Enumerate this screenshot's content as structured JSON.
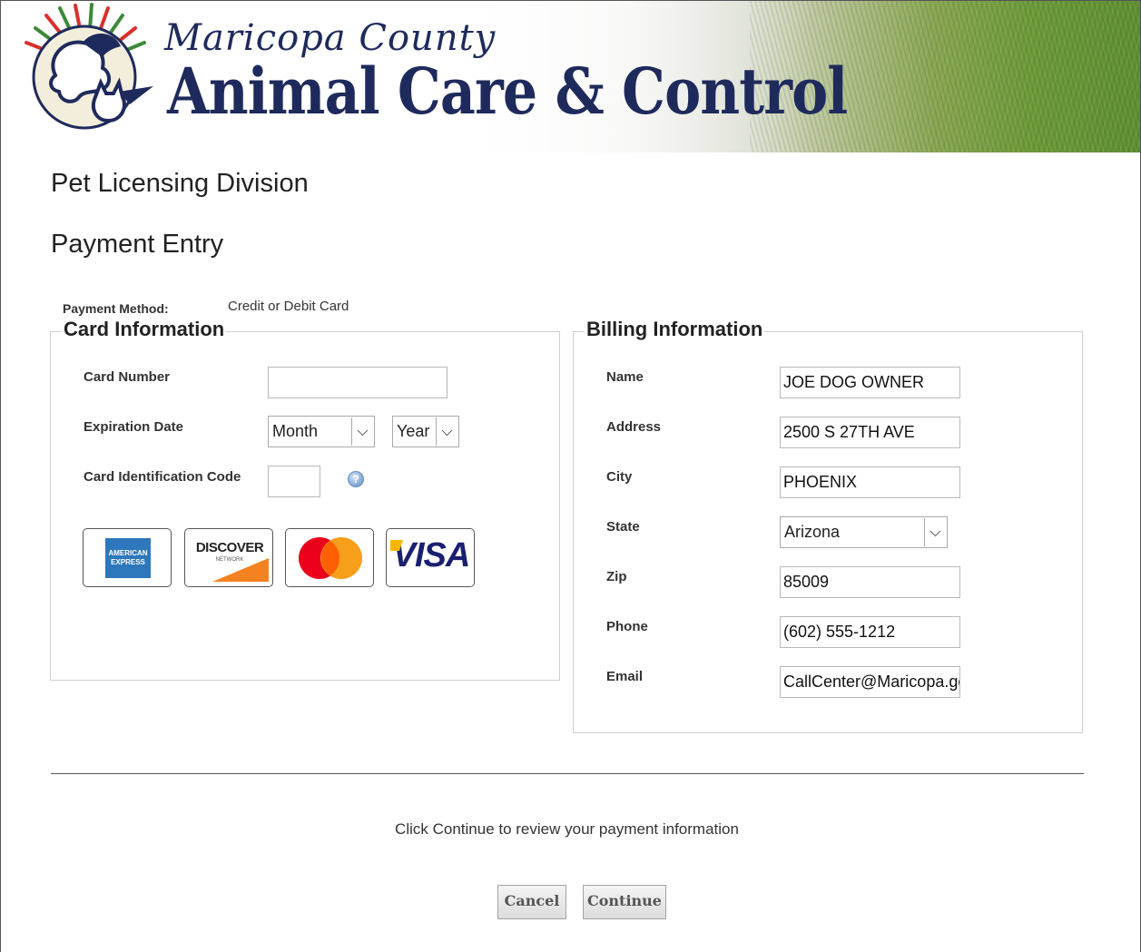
{
  "header": {
    "brand_top": "Maricopa County",
    "brand_main": "Animal Care & Control"
  },
  "page": {
    "division": "Pet Licensing Division",
    "title": "Payment Entry"
  },
  "payment_method": {
    "label": "Payment Method:",
    "value": "Credit or Debit Card"
  },
  "card_info": {
    "legend": "Card Information",
    "card_number_label": "Card Number",
    "card_number_value": "",
    "expiration_label": "Expiration Date",
    "month_selected": "Month",
    "year_selected": "Year",
    "cid_label": "Card Identification Code",
    "cid_value": "",
    "help_icon": "question-mark-icon",
    "cards": {
      "amex_line1": "AMERICAN",
      "amex_line2": "EXPRESS",
      "discover": "DISCOVER",
      "discover_sub": "NETWORK",
      "visa": "VISA"
    }
  },
  "billing": {
    "legend": "Billing Information",
    "fields": {
      "name_label": "Name",
      "name_value": "JOE DOG OWNER",
      "address_label": "Address",
      "address_value": "2500 S 27TH AVE",
      "city_label": "City",
      "city_value": "PHOENIX",
      "state_label": "State",
      "state_value": "Arizona",
      "zip_label": "Zip",
      "zip_value": "85009",
      "phone_label": "Phone",
      "phone_value": "(602) 555-1212",
      "email_label": "Email",
      "email_value": "CallCenter@Maricopa.gc"
    }
  },
  "footer": {
    "hint": "Click Continue to review your payment information",
    "cancel_label": "Cancel",
    "continue_label": "Continue"
  },
  "colors": {
    "brand_navy": "#1f2a5c",
    "mastercard_red": "#eb001b",
    "mastercard_orange": "#f79e1b",
    "visa_blue": "#1a1f71",
    "amex_blue": "#2e77bc",
    "discover_orange": "#f58220"
  }
}
